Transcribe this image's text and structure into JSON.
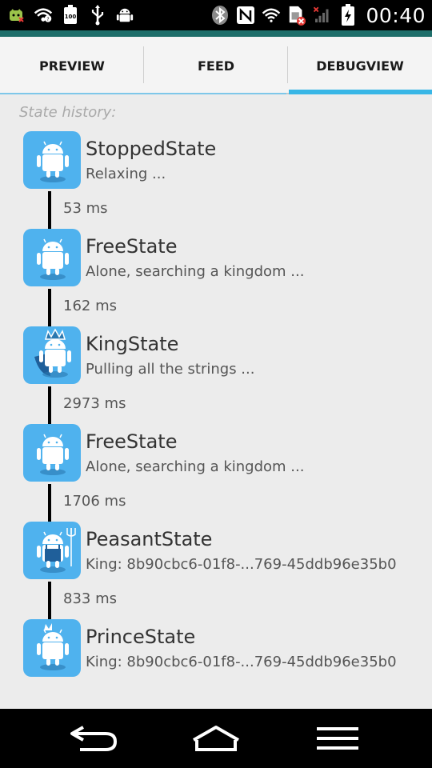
{
  "status_bar": {
    "time": "00:40",
    "icons": [
      "usb-debugging-icon",
      "wifi-calling-icon",
      "battery-100-icon",
      "usb-icon",
      "android-icon",
      "bluetooth-icon",
      "nfc-icon",
      "wifi-icon",
      "sim-error-icon",
      "no-signal-icon",
      "battery-charging-icon"
    ],
    "battery_label": "100"
  },
  "tabs": {
    "items": [
      {
        "label": "PREVIEW",
        "selected": false
      },
      {
        "label": "FEED",
        "selected": false
      },
      {
        "label": "DEBUGVIEW",
        "selected": true
      }
    ],
    "indicator_color": "#38b6e6"
  },
  "history": {
    "header": "State history:",
    "entries": [
      {
        "name": "StoppedState",
        "description": "Relaxing ...",
        "icon": "android-plain-icon",
        "duration": "53 ms"
      },
      {
        "name": "FreeState",
        "description": "Alone, searching a kingdom ...",
        "icon": "android-plain-icon",
        "duration": "162 ms"
      },
      {
        "name": "KingState",
        "description": "Pulling all the strings ...",
        "icon": "android-king-icon",
        "duration": "2973 ms"
      },
      {
        "name": "FreeState",
        "description": "Alone, searching a kingdom ...",
        "icon": "android-plain-icon",
        "duration": "1706 ms"
      },
      {
        "name": "PeasantState",
        "description": "King: 8b90cbc6-01f8-...769-45ddb96e35b0",
        "icon": "android-peasant-icon",
        "duration": "833 ms"
      },
      {
        "name": "PrinceState",
        "description": "King: 8b90cbc6-01f8-...769-45ddb96e35b0",
        "icon": "android-prince-icon",
        "duration": ""
      }
    ]
  },
  "nav": {
    "buttons": [
      "back-button",
      "home-button",
      "menu-button"
    ]
  },
  "colors": {
    "accent": "#38b6e6",
    "avatar_bg": "#4fb2ee",
    "statusbar_strip": "#1e6e6a"
  }
}
